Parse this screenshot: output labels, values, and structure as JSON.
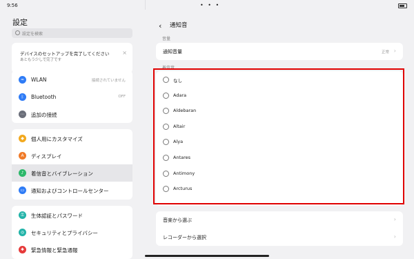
{
  "status_bar": {
    "time": "9:56",
    "dots": "• • •"
  },
  "left_panel": {
    "title": "設定",
    "search_placeholder": "設定を検索",
    "setup_card": {
      "line1": "デバイスのセットアップを完了してください",
      "line2": "あともう少しで完了です",
      "close": "×"
    },
    "group1": [
      {
        "label": "WLAN",
        "value": "接続されていません",
        "icon": "wifi-icon",
        "color": "#2f7cf6",
        "glyph": "≈"
      },
      {
        "label": "Bluetooth",
        "value": "OFF",
        "icon": "bluetooth-icon",
        "color": "#2f7cf6",
        "glyph": "ᛒ"
      },
      {
        "label": "追加の接続",
        "value": "",
        "icon": "more-icon",
        "color": "#6b6f7a",
        "glyph": "⋯"
      }
    ],
    "group2": [
      {
        "label": "個人用にカスタマイズ",
        "icon": "customize-icon",
        "color": "#f2a91f",
        "glyph": "◆"
      },
      {
        "label": "ディスプレイ",
        "icon": "display-icon",
        "color": "#f07a28",
        "glyph": "A"
      },
      {
        "label": "着信音とバイブレーション",
        "icon": "sound-icon",
        "color": "#2db86b",
        "glyph": "♪"
      },
      {
        "label": "通知およびコントロールセンター",
        "icon": "notification-icon",
        "color": "#2f7cf6",
        "glyph": "▭"
      }
    ],
    "group3": [
      {
        "label": "生体認証とパスワード",
        "icon": "biometric-icon",
        "color": "#22b3a8",
        "glyph": "⚿"
      },
      {
        "label": "セキュリティとプライバシー",
        "icon": "security-icon",
        "color": "#22b3a8",
        "glyph": "◎"
      },
      {
        "label": "緊急情報と緊急通報",
        "icon": "emergency-icon",
        "color": "#e63a3a",
        "glyph": "✱"
      }
    ]
  },
  "right_panel": {
    "back": "‹",
    "title": "通知音",
    "volume_section": "音量",
    "volume_row": {
      "label": "通知音量",
      "value": "正常",
      "chev": "›"
    },
    "ringtone_section": "着信音",
    "ringtones": [
      "なし",
      "Adara",
      "Aldebaran",
      "Altair",
      "Alya",
      "Antares",
      "Antimony",
      "Arcturus"
    ],
    "bottom_rows": [
      {
        "label": "音楽から選ぶ",
        "chev": "›"
      },
      {
        "label": "レコーダーから選択",
        "chev": "›"
      }
    ]
  }
}
